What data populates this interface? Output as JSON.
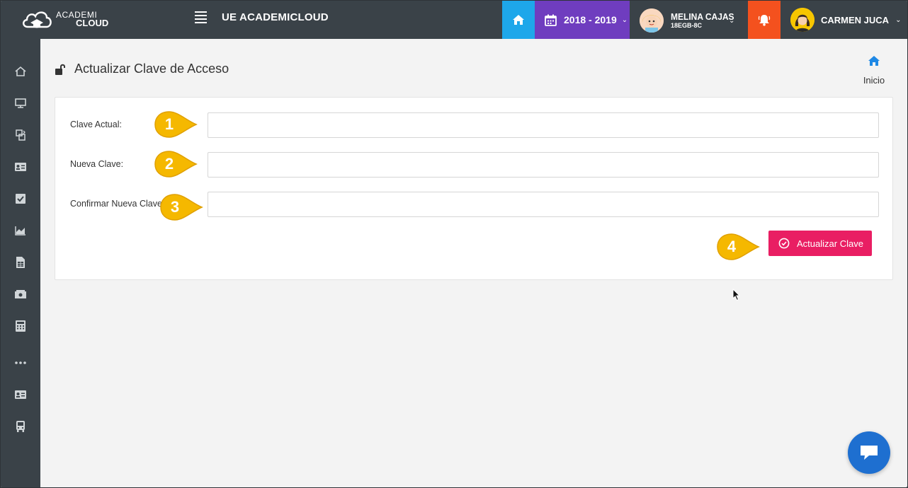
{
  "header": {
    "logo": {
      "line1": "ACADEMI",
      "line2": "CLOUD"
    },
    "school_name": "UE ACADEMICLOUD",
    "school_year": "2018 - 2019",
    "student": {
      "name": "MELINA CAJAS",
      "code": "18EGB-8C"
    },
    "user": {
      "name": "CARMEN JUCA"
    },
    "colors": {
      "home": "#1ea7ea",
      "year": "#6f3dbf",
      "alerts": "#f4511e",
      "bar": "#3a4248"
    }
  },
  "sidebar": {
    "items": [
      {
        "icon": "home-icon"
      },
      {
        "icon": "monitor-icon"
      },
      {
        "icon": "transfer-icon"
      },
      {
        "icon": "id-card-icon"
      },
      {
        "icon": "checkbox-icon"
      },
      {
        "icon": "area-chart-icon"
      },
      {
        "icon": "spreadsheet-icon"
      },
      {
        "icon": "money-icon"
      },
      {
        "icon": "calculator-icon"
      },
      {
        "icon": "more-icon"
      },
      {
        "icon": "id-card-icon"
      },
      {
        "icon": "bus-icon"
      }
    ]
  },
  "page": {
    "title": "Actualizar Clave de Acceso",
    "breadcrumb": "Inicio"
  },
  "form": {
    "fields": [
      {
        "label": "Clave Actual:",
        "value": "",
        "marker": "1"
      },
      {
        "label": "Nueva Clave:",
        "value": "",
        "marker": "2"
      },
      {
        "label": "Confirmar Nueva Clave:",
        "value": "",
        "marker": "3"
      }
    ],
    "submit": {
      "label": "Actualizar Clave",
      "marker": "4",
      "color": "#e91e63"
    }
  },
  "chat": {
    "icon": "chat-icon"
  }
}
